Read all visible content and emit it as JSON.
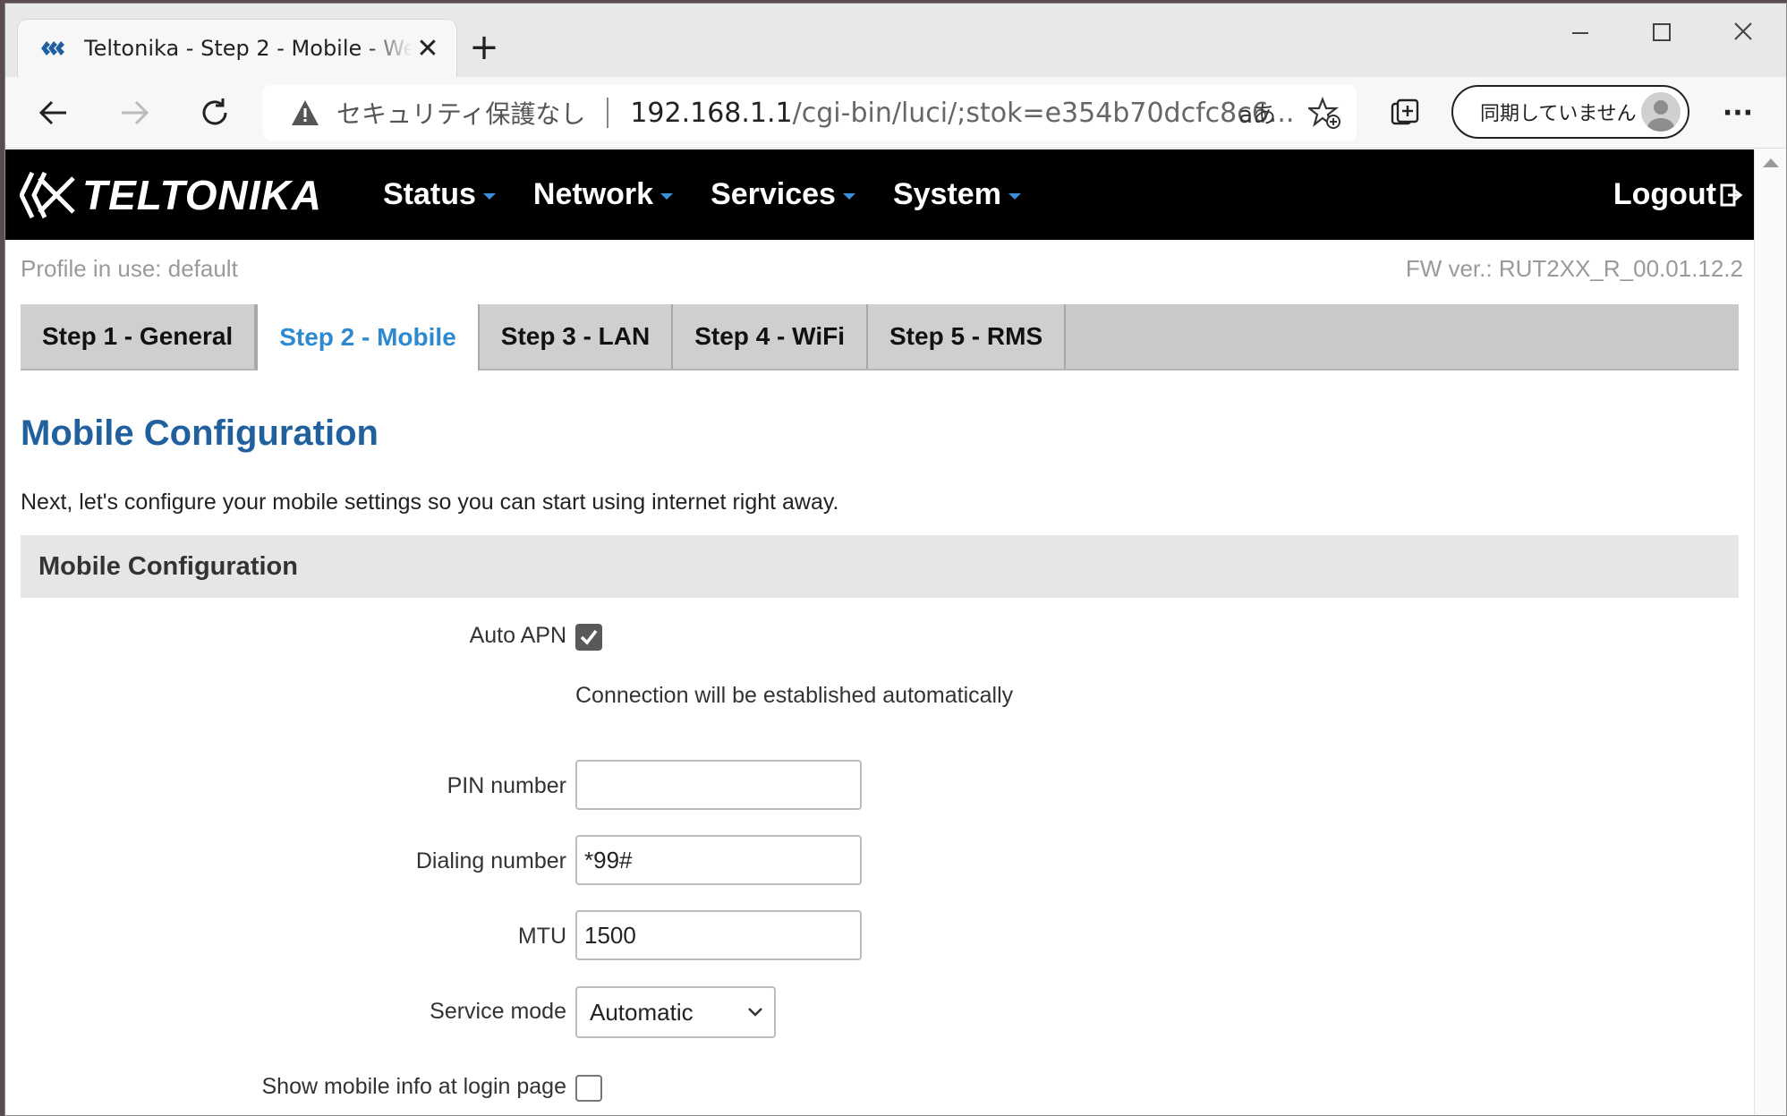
{
  "browser": {
    "tab_title": "Teltonika - Step 2 - Mobile - Web",
    "new_tab_symbol": "+",
    "security_label": "セキュリティ保護なし",
    "url_host": "192.168.1.1",
    "url_path": "/cgi-bin/luci/;stok=e354b70dcfc8c6...",
    "read_aloud_symbol": "aあ",
    "sync_label": "同期していません",
    "more_symbol": "···"
  },
  "nav": {
    "brand": "TELTONIKA",
    "menu": [
      {
        "label": "Status"
      },
      {
        "label": "Network"
      },
      {
        "label": "Services"
      },
      {
        "label": "System"
      }
    ],
    "logout": "Logout"
  },
  "info": {
    "profile": "Profile in use: default",
    "fw": "FW ver.: RUT2XX_R_00.01.12.2"
  },
  "steps": [
    {
      "label": "Step 1 - General",
      "active": false
    },
    {
      "label": "Step 2 - Mobile",
      "active": true
    },
    {
      "label": "Step 3 - LAN",
      "active": false
    },
    {
      "label": "Step 4 - WiFi",
      "active": false
    },
    {
      "label": "Step 5 - RMS",
      "active": false
    }
  ],
  "main": {
    "title": "Mobile Configuration",
    "description": "Next, let's configure your mobile settings so you can start using internet right away.",
    "section_title": "Mobile Configuration"
  },
  "form": {
    "auto_apn": {
      "label": "Auto APN",
      "checked": true,
      "hint": "Connection will be established automatically"
    },
    "pin": {
      "label": "PIN number",
      "value": ""
    },
    "dialing": {
      "label": "Dialing number",
      "value": "*99#"
    },
    "mtu": {
      "label": "MTU",
      "value": "1500"
    },
    "service_mode": {
      "label": "Service mode",
      "value": "Automatic"
    },
    "show_mobile_info": {
      "label": "Show mobile info at login page",
      "checked": false
    }
  },
  "colors": {
    "accent_blue": "#2d89d0",
    "heading_blue": "#21609e",
    "navbar_bg": "#000000"
  }
}
